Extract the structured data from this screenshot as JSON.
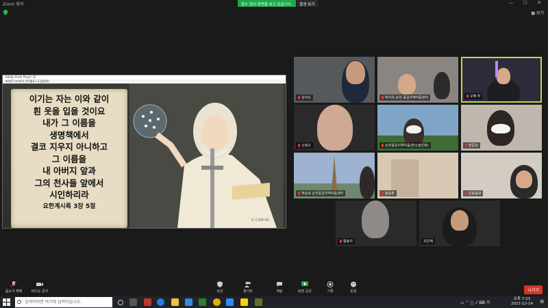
{
  "window": {
    "title": "Zoom 회의",
    "controls": "— ☐ ✕"
  },
  "share_bar": {
    "message": "참수 업이 화면을 보고 있습니다.",
    "options_label": "옵션 보기"
  },
  "view_button": "보기",
  "shared_window": {
    "title": "Adobe Flash Player 32",
    "menu": "파일(F)  보기(V)  컨트롤(C)  도움말(H)",
    "verse_lines": [
      "이기는 자는 이와 같이",
      "흰 옷을 입을 것이요",
      "내가 그 이름을",
      "생명책에서",
      "결코 지우지 아니하고",
      "그 이름을",
      "내 아버지 앞과",
      "그의 천사들 앞에서",
      "시인하리라"
    ],
    "verse_reference": "요한계시록 3장 5절",
    "watermark": "© CDM KR"
  },
  "participants": [
    {
      "name": "김이도",
      "muted": true
    },
    {
      "name": "박지유-순천 동일지역아동센터",
      "muted": true
    },
    {
      "name": "오혜 박",
      "muted": true,
      "active": true
    },
    {
      "name": "신정규",
      "muted": true
    },
    {
      "name": "순천동일지역아동센터(정선화)",
      "muted": true
    },
    {
      "name": "방준모",
      "muted": true
    },
    {
      "name": "박승희 순천동일지역아동센터",
      "muted": true
    },
    {
      "name": "정승환",
      "muted": true
    },
    {
      "name": "운송동화",
      "muted": true
    },
    {
      "name": "황송지",
      "muted": true
    },
    {
      "name": "조은혜",
      "muted": false
    }
  ],
  "toolbar": {
    "audio": "음소거 해제",
    "video": "비디오 중지",
    "security": "보안",
    "participants": "참가자",
    "participants_count": "11",
    "chat": "채팅",
    "share": "화면 공유",
    "record": "기록",
    "reactions": "반응",
    "leave": "나가기"
  },
  "taskbar": {
    "search_placeholder": "검색하려면 여기에 입력하십시오.",
    "time": "오후 7:23",
    "date": "2021-12-14"
  },
  "colors": {
    "share_green": "#1fa84a",
    "leave_red": "#d9332b",
    "active_border": "#c7d34a"
  }
}
